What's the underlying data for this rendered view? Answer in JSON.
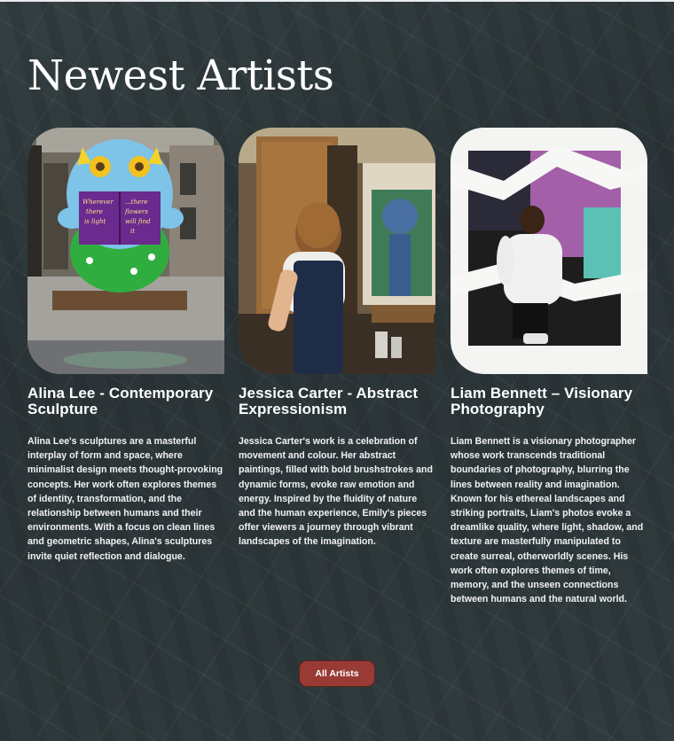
{
  "page": {
    "heading": "Newest Artists"
  },
  "artists": [
    {
      "name": "Alina Lee - Contemporary Sculpture",
      "bio": "Alina Lee's sculptures are a masterful interplay of form and space, where minimalist design meets thought-provoking concepts. Her work often explores themes of identity, transformation, and the relationship between humans and their environments. With a focus on clean lines and geometric shapes, Alina's sculptures invite quiet reflection and dialogue.",
      "image_sign_left": "Wherever there is light",
      "image_sign_right": "...there flowers will find it"
    },
    {
      "name": "Jessica Carter - Abstract Expressionism",
      "bio": "Jessica Carter's work is a celebration of movement and colour. Her abstract paintings, filled with bold brushstrokes and dynamic forms, evoke raw emotion and energy. Inspired by the fluidity of nature and the human experience, Emily's pieces offer viewers a journey through vibrant landscapes of the imagination."
    },
    {
      "name": "Liam Bennett – Visionary Photography",
      "bio": "Liam Bennett is a visionary photographer whose work transcends traditional boundaries of photography, blurring the lines between reality and imagination. Known for his ethereal landscapes and striking portraits, Liam's photos evoke a dreamlike quality, where light, shadow, and texture are masterfully manipulated to create surreal, otherworldly scenes. His work often explores themes of time, memory, and the unseen connections between humans and the natural world."
    }
  ],
  "cta": {
    "label": "All Artists"
  },
  "colors": {
    "background": "#2c3639",
    "button": "#9a3a35",
    "text": "#ffffff"
  }
}
